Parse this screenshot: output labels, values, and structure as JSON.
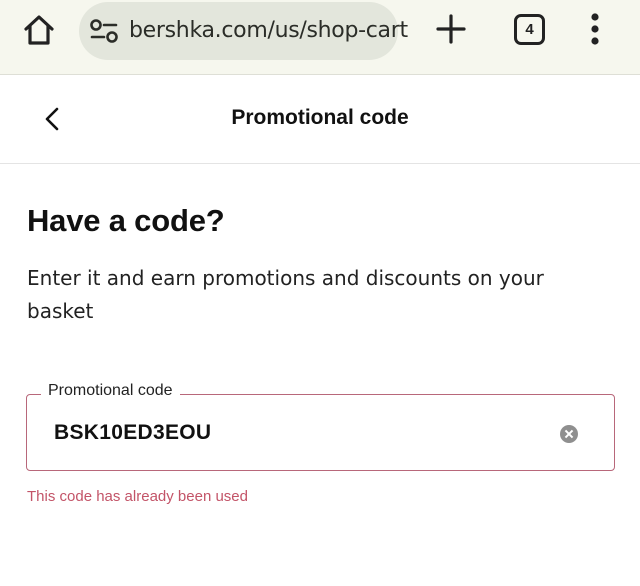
{
  "browser": {
    "url": "bershka.com/us/shop-cart",
    "tab_count": "4",
    "icons": [
      "home-icon",
      "site-settings-icon",
      "plus-icon",
      "tabs-icon",
      "more-vert-icon"
    ]
  },
  "header": {
    "title": "Promotional code",
    "back_icon": "chevron-left-icon"
  },
  "main": {
    "heading": "Have a code?",
    "description": "Enter it and earn promotions and discounts on your basket",
    "promo_field": {
      "label": "Promotional code",
      "value": "BSK10ED3EOU",
      "clear_icon": "clear-circle-icon"
    },
    "error": "This code has already been used"
  },
  "colors": {
    "error": "#c35468",
    "field_border": "#b8677a",
    "browser_bar": "#f6f7ee",
    "url_pill": "#e3e6dc"
  }
}
